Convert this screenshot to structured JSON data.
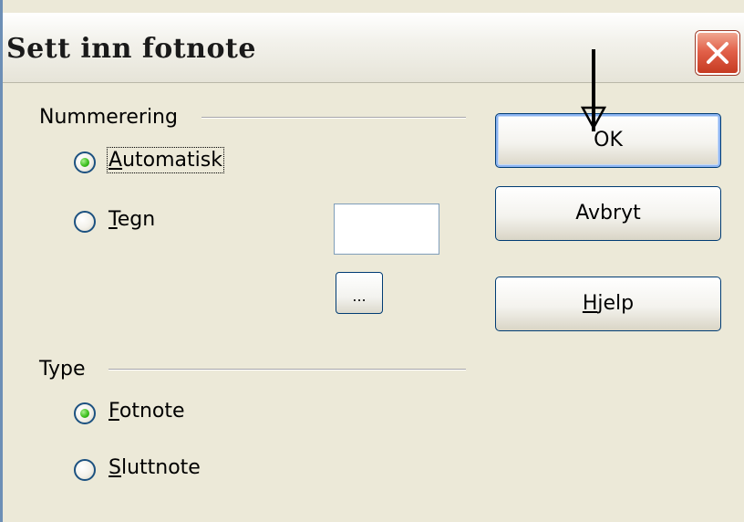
{
  "window": {
    "title": "Sett inn fotnote",
    "close_icon": "close-icon"
  },
  "numbering": {
    "group_label": "Nummerering",
    "options": [
      {
        "first": "A",
        "rest": "utomatisk",
        "selected": true
      },
      {
        "first": "T",
        "rest": "egn",
        "selected": false
      }
    ],
    "character_value": "",
    "browse_label": "..."
  },
  "type": {
    "group_label": "Type",
    "options": [
      {
        "first": "F",
        "rest": "otnote",
        "selected": true
      },
      {
        "first": "S",
        "rest": "luttnote",
        "selected": false
      }
    ]
  },
  "buttons": {
    "ok": "OK",
    "cancel": "Avbryt",
    "help_first": "H",
    "help_rest": "jelp"
  },
  "colors": {
    "dialog_bg": "#ece9d8",
    "close_red": "#e2614a",
    "radio_green": "#3ec01f",
    "button_border": "#003c74"
  }
}
